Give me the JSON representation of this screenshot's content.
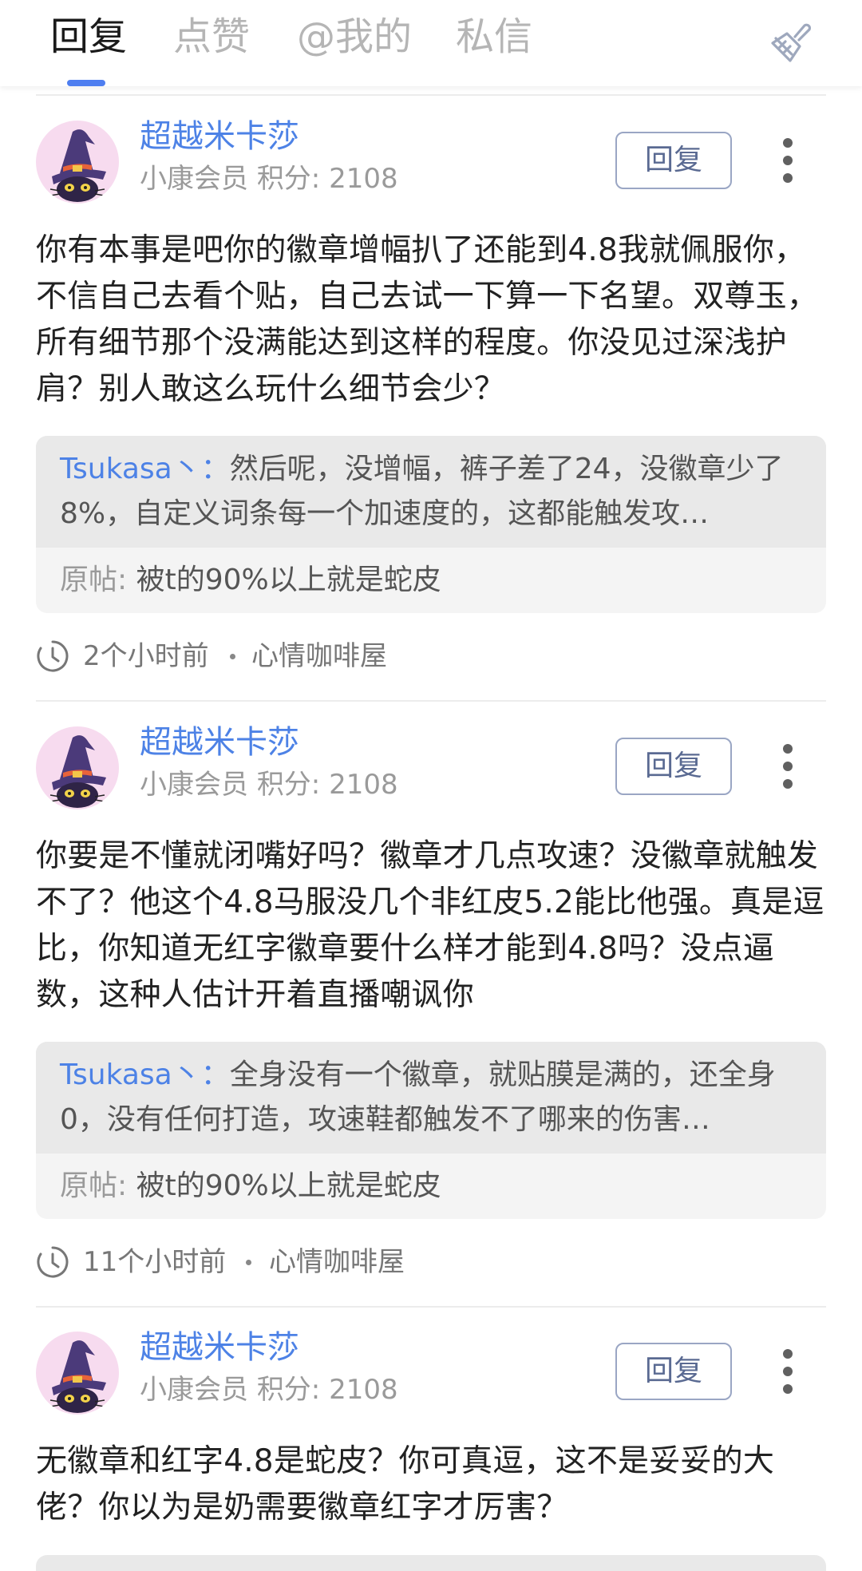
{
  "tabs": [
    {
      "label": "回复",
      "active": true
    },
    {
      "label": "点赞",
      "active": false
    },
    {
      "label": "@我的",
      "active": false
    },
    {
      "label": "私信",
      "active": false
    }
  ],
  "clear_icon": "broom-icon",
  "colors": {
    "accent": "#4e7ef0",
    "username": "#4d82e6",
    "reply_button_border": "#9aa6c4",
    "avatar_bg": "#f7dbef",
    "quote_top_bg": "#e9e9e9",
    "quote_bottom_bg": "#f4f4f4"
  },
  "posts": [
    {
      "username": "超越米卡莎",
      "level": "小康会员",
      "score": "积分: 2108",
      "reply_label": "回复",
      "content": "你有本事是吧你的徽章增幅扒了还能到4.8我就佩服你，不信自己去看个贴，自己去试一下算一下名望。双尊玉，所有细节那个没满能达到这样的程度。你没见过深浅护肩？别人敢这么玩什么细节会少？",
      "quote_author": "Tsukasa丶",
      "quote_sep": "：",
      "quote_text": "然后呢，没增幅，裤子差了24，没徽章少了8%，自定义词条每一个加速度的，这都能触发攻…",
      "orig_label": "原帖:",
      "orig_title": "被t的90%以上就是蛇皮",
      "time": "2个小时前",
      "board": "心情咖啡屋"
    },
    {
      "username": "超越米卡莎",
      "level": "小康会员",
      "score": "积分: 2108",
      "reply_label": "回复",
      "content": "你要是不懂就闭嘴好吗？徽章才几点攻速？没徽章就触发不了？他这个4.8马服没几个非红皮5.2能比他强。真是逗比，你知道无红字徽章要什么样才能到4.8吗？没点逼数，这种人估计开着直播嘲讽你",
      "quote_author": "Tsukasa丶",
      "quote_sep": "：",
      "quote_text": "全身没有一个徽章，就贴膜是满的，还全身0，没有任何打造，攻速鞋都触发不了哪来的伤害…",
      "orig_label": "原帖:",
      "orig_title": "被t的90%以上就是蛇皮",
      "time": "11个小时前",
      "board": "心情咖啡屋"
    },
    {
      "username": "超越米卡莎",
      "level": "小康会员",
      "score": "积分: 2108",
      "reply_label": "回复",
      "content": "无徽章和红字4.8是蛇皮？你可真逗，这不是妥妥的大佬？你以为是奶需要徽章红字才厉害？"
    }
  ]
}
